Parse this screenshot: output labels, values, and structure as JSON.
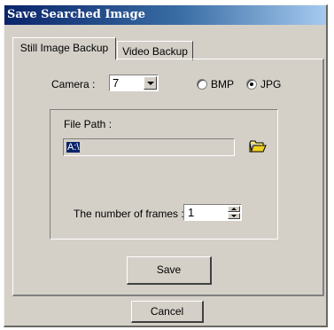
{
  "window": {
    "title": "Save Searched Image"
  },
  "tabs": [
    {
      "label": "Still Image Backup",
      "active": true
    },
    {
      "label": "Video Backup",
      "active": false
    }
  ],
  "camera": {
    "label": "Camera :",
    "value": "7",
    "format_options": [
      {
        "label": "BMP",
        "selected": false
      },
      {
        "label": "JPG",
        "selected": true
      }
    ]
  },
  "file_path": {
    "label": "File Path :",
    "value": "A:\\",
    "browse_icon": "folder-icon"
  },
  "frames": {
    "label": "The number of frames :",
    "value": "1"
  },
  "buttons": {
    "save_label": "Save",
    "cancel_label": "Cancel"
  },
  "colors": {
    "titlebar_start": "#0a246a",
    "titlebar_end": "#a6caf0",
    "face": "#d4d0c8",
    "selection": "#0a246a"
  }
}
